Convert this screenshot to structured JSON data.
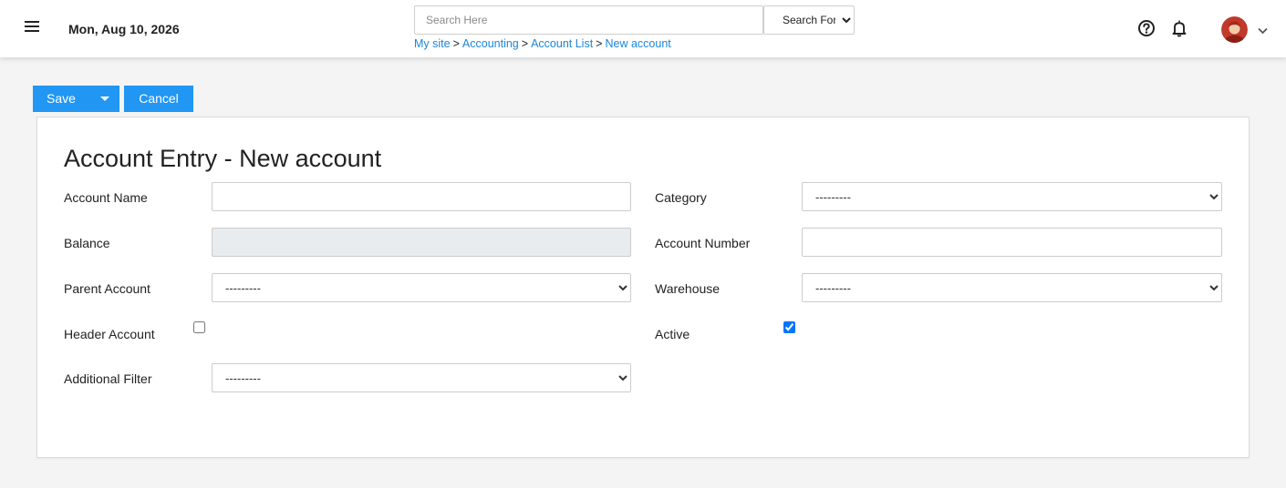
{
  "header": {
    "date": "Mon, Aug 10, 2026",
    "search": {
      "placeholder": "Search Here",
      "value": ""
    },
    "search_for": {
      "selected": "Search For..."
    },
    "breadcrumb": [
      {
        "label": "My site"
      },
      {
        "label": "Accounting"
      },
      {
        "label": "Account List"
      },
      {
        "label": "New account"
      }
    ],
    "breadcrumb_separator": ">",
    "icons": {
      "menu": "menu-icon",
      "help": "help-icon",
      "notifications": "bell-icon",
      "user": "avatar",
      "user_menu": "chevron-down-icon"
    }
  },
  "toolbar": {
    "save_label": "Save",
    "cancel_label": "Cancel",
    "accent_color": "#2196f3"
  },
  "form": {
    "title": "Account Entry - New account",
    "fields": {
      "account_name": {
        "label": "Account Name",
        "value": ""
      },
      "balance": {
        "label": "Balance",
        "value": ""
      },
      "parent_account": {
        "label": "Parent Account",
        "selected": "---------"
      },
      "header_account": {
        "label": "Header Account",
        "checked": false
      },
      "additional_filter": {
        "label": "Additional Filter",
        "selected": "---------"
      },
      "category": {
        "label": "Category",
        "selected": "---------"
      },
      "account_number": {
        "label": "Account Number",
        "value": ""
      },
      "warehouse": {
        "label": "Warehouse",
        "selected": "---------"
      },
      "active": {
        "label": "Active",
        "checked": true
      }
    }
  }
}
